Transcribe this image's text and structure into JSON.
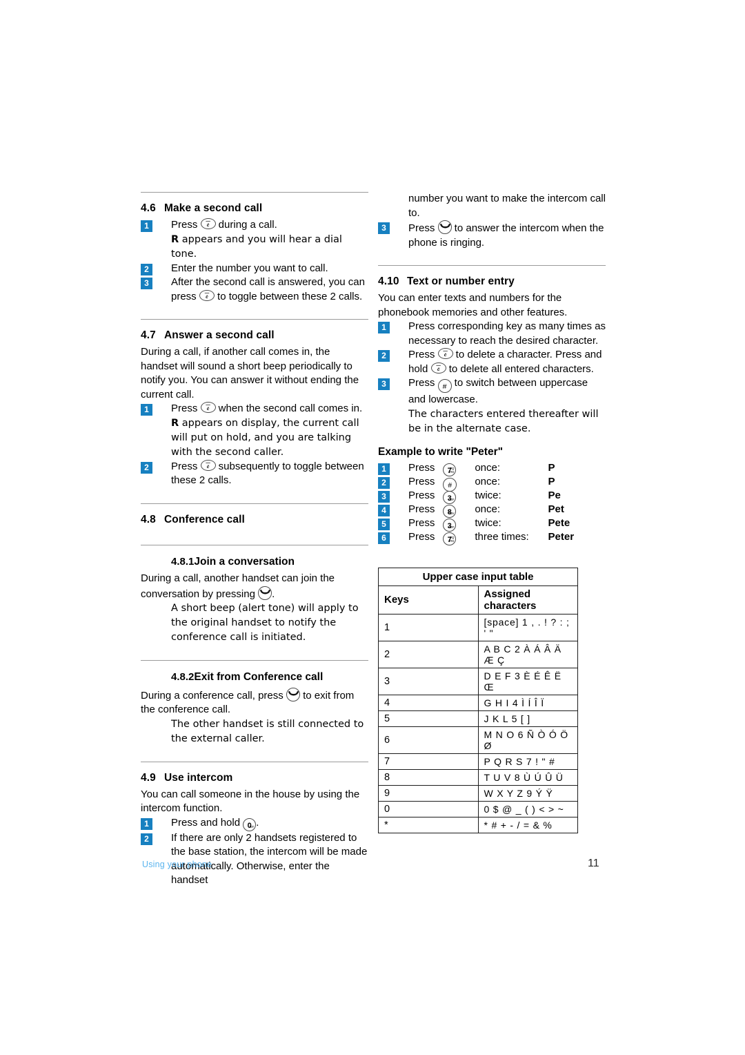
{
  "document": {
    "footer_label": "Using your phone",
    "page_number": "11",
    "accent_color": "#1780c0",
    "footer_color": "#5ab4ee"
  },
  "left_column": {
    "sections": [
      {
        "number": "4.6",
        "title": "Make a second call",
        "steps": [
          "Press   during a call.",
          "Enter the number you want to call.",
          "After the second call is answered, you can press   to toggle between these 2 calls."
        ],
        "note": "R appears and you will hear a dial tone."
      },
      {
        "number": "4.7",
        "title": "Answer a second call",
        "intro": "During a call, if another call comes in, the handset will sound a short beep periodically to notify you. You can answer it without ending the current call.",
        "steps": [
          "Press   when the second call comes in.",
          "Press   subsequently to toggle between these 2 calls."
        ],
        "note": "R appears on display, the current call will put on hold, and you are talking with the second caller."
      },
      {
        "number": "4.8",
        "title": "Conference call"
      },
      {
        "number": "4.8.1",
        "title": "Join a conversation",
        "intro": "During a call, another handset can join the conversation by pressing   .",
        "note": "A short beep (alert tone) will apply to the original handset to notify the conference call is initiated."
      },
      {
        "number": "4.8.2",
        "title": "Exit from Conference call",
        "intro": "During a conference call, press   to exit from the conference call.",
        "note": "The other handset is still connected to the external caller."
      },
      {
        "number": "4.9",
        "title": "Use intercom",
        "intro": "You can call someone in the house by using the intercom function.",
        "steps": [
          "Press and hold   .",
          "If there are only 2 handsets registered to the base station, the intercom will be made automatically. Otherwise, enter the handset"
        ]
      }
    ]
  },
  "right_column": {
    "continued_text": "number you want to make the intercom call to.",
    "continued_step": {
      "number": "3",
      "text": "Press   to answer the intercom when the phone is ringing."
    },
    "sections": [
      {
        "number": "4.10",
        "title": "Text or number entry",
        "intro": "You can enter texts and numbers for the phonebook memories and other features.",
        "steps": [
          "Press corresponding key as many times as necessary to reach the desired character.",
          "Press   to delete a character. Press and hold   to delete all entered characters.",
          "Press   to switch between uppercase and lowercase."
        ],
        "note": "The characters entered thereafter will be in the alternate case."
      }
    ],
    "example": {
      "title": "Example to write \"Peter\"",
      "press_label": "Press",
      "rows": [
        {
          "step": "1",
          "key": "7",
          "key_sub": "PQRS",
          "times": "once:",
          "result": "P"
        },
        {
          "step": "2",
          "key": "#",
          "key_sub": "",
          "times": "once:",
          "result": "P"
        },
        {
          "step": "3",
          "key": "3",
          "key_sub": "DEF",
          "times": "twice:",
          "result": "Pe"
        },
        {
          "step": "4",
          "key": "8",
          "key_sub": "TUV",
          "times": "once:",
          "result": "Pet"
        },
        {
          "step": "5",
          "key": "3",
          "key_sub": "DEF",
          "times": "twice:",
          "result": "Pete"
        },
        {
          "step": "6",
          "key": "7",
          "key_sub": "PQRS",
          "times": "three times:",
          "result": "Peter"
        }
      ]
    },
    "table": {
      "title": "Upper case input table",
      "headers": [
        "Keys",
        "Assigned characters"
      ],
      "rows": [
        [
          "1",
          "[space] 1 , . ! ? : ; ' \""
        ],
        [
          "2",
          "A B C 2 À Á Â Ä Æ Ç"
        ],
        [
          "3",
          "D E F 3 È É Ê Ë Œ"
        ],
        [
          "4",
          "G H I 4 Ì Í Î Ï"
        ],
        [
          "5",
          "J K L 5 [ ]"
        ],
        [
          "6",
          "M N O 6 Ñ Ò Ó Ö Ø"
        ],
        [
          "7",
          "P Q R S 7  !  \"  #"
        ],
        [
          "8",
          "T U V 8 Ù Ú Û Ü"
        ],
        [
          "9",
          "W X Y Z 9 Ý Ÿ"
        ],
        [
          "0",
          "0 $  @ _ ( ) < > ~"
        ],
        [
          "*",
          "* # + - / = & %"
        ]
      ]
    }
  }
}
